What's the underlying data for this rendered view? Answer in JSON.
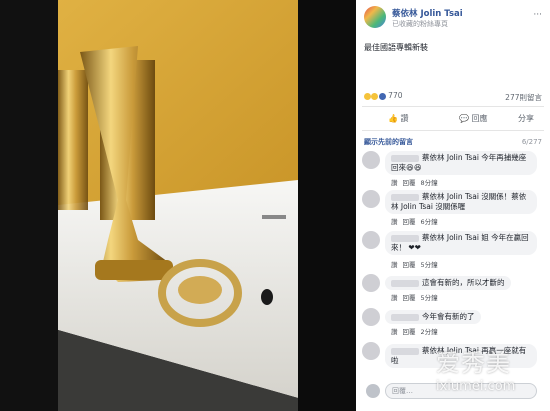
{
  "post": {
    "author": "蔡依林 Jolin Tsai",
    "subtitle": "已收藏的粉絲專頁",
    "dots": "···",
    "text": "最佳國語專輯新裝",
    "reaction_count": "770",
    "comment_count": "277則留言",
    "actions": {
      "like": "讚",
      "comment": "回應",
      "share": "分享"
    }
  },
  "comments_header": {
    "sort_label": "顯示先前的留言",
    "paging": "6/277"
  },
  "comments": [
    {
      "text": "蔡依林 Jolin Tsai 今年再捕幾座回來😆😆",
      "like": "讚",
      "reply": "回覆",
      "time": "8分鐘"
    },
    {
      "text": "蔡依林 Jolin Tsai 沒關係！蔡依林 Jolin Tsai 沒關係喔",
      "like": "讚",
      "reply": "回覆",
      "time": "6分鐘"
    },
    {
      "text": "蔡依林 Jolin Tsai 姐 今年在贏回來！ ❤❤",
      "like": "讚",
      "reply": "回覆",
      "time": "5分鐘"
    },
    {
      "text": "這會有新的，所以才斷的",
      "like": "讚",
      "reply": "回覆",
      "time": "5分鐘"
    },
    {
      "text": "今年會有新的了",
      "like": "讚",
      "reply": "回覆",
      "time": "2分鐘"
    },
    {
      "text": "蔡依林 Jolin Tsai 再贏一座就有啦",
      "like": "讚",
      "reply": "回覆",
      "time": ""
    }
  ],
  "reply_box": {
    "placeholder": "回覆…"
  },
  "watermark": {
    "cn": "爱秀美",
    "url": "ixiumei.com"
  },
  "colors": {
    "fb_blue": "#365899",
    "wall_yellow": "#d7a93b",
    "gold": "#c8a24a"
  }
}
